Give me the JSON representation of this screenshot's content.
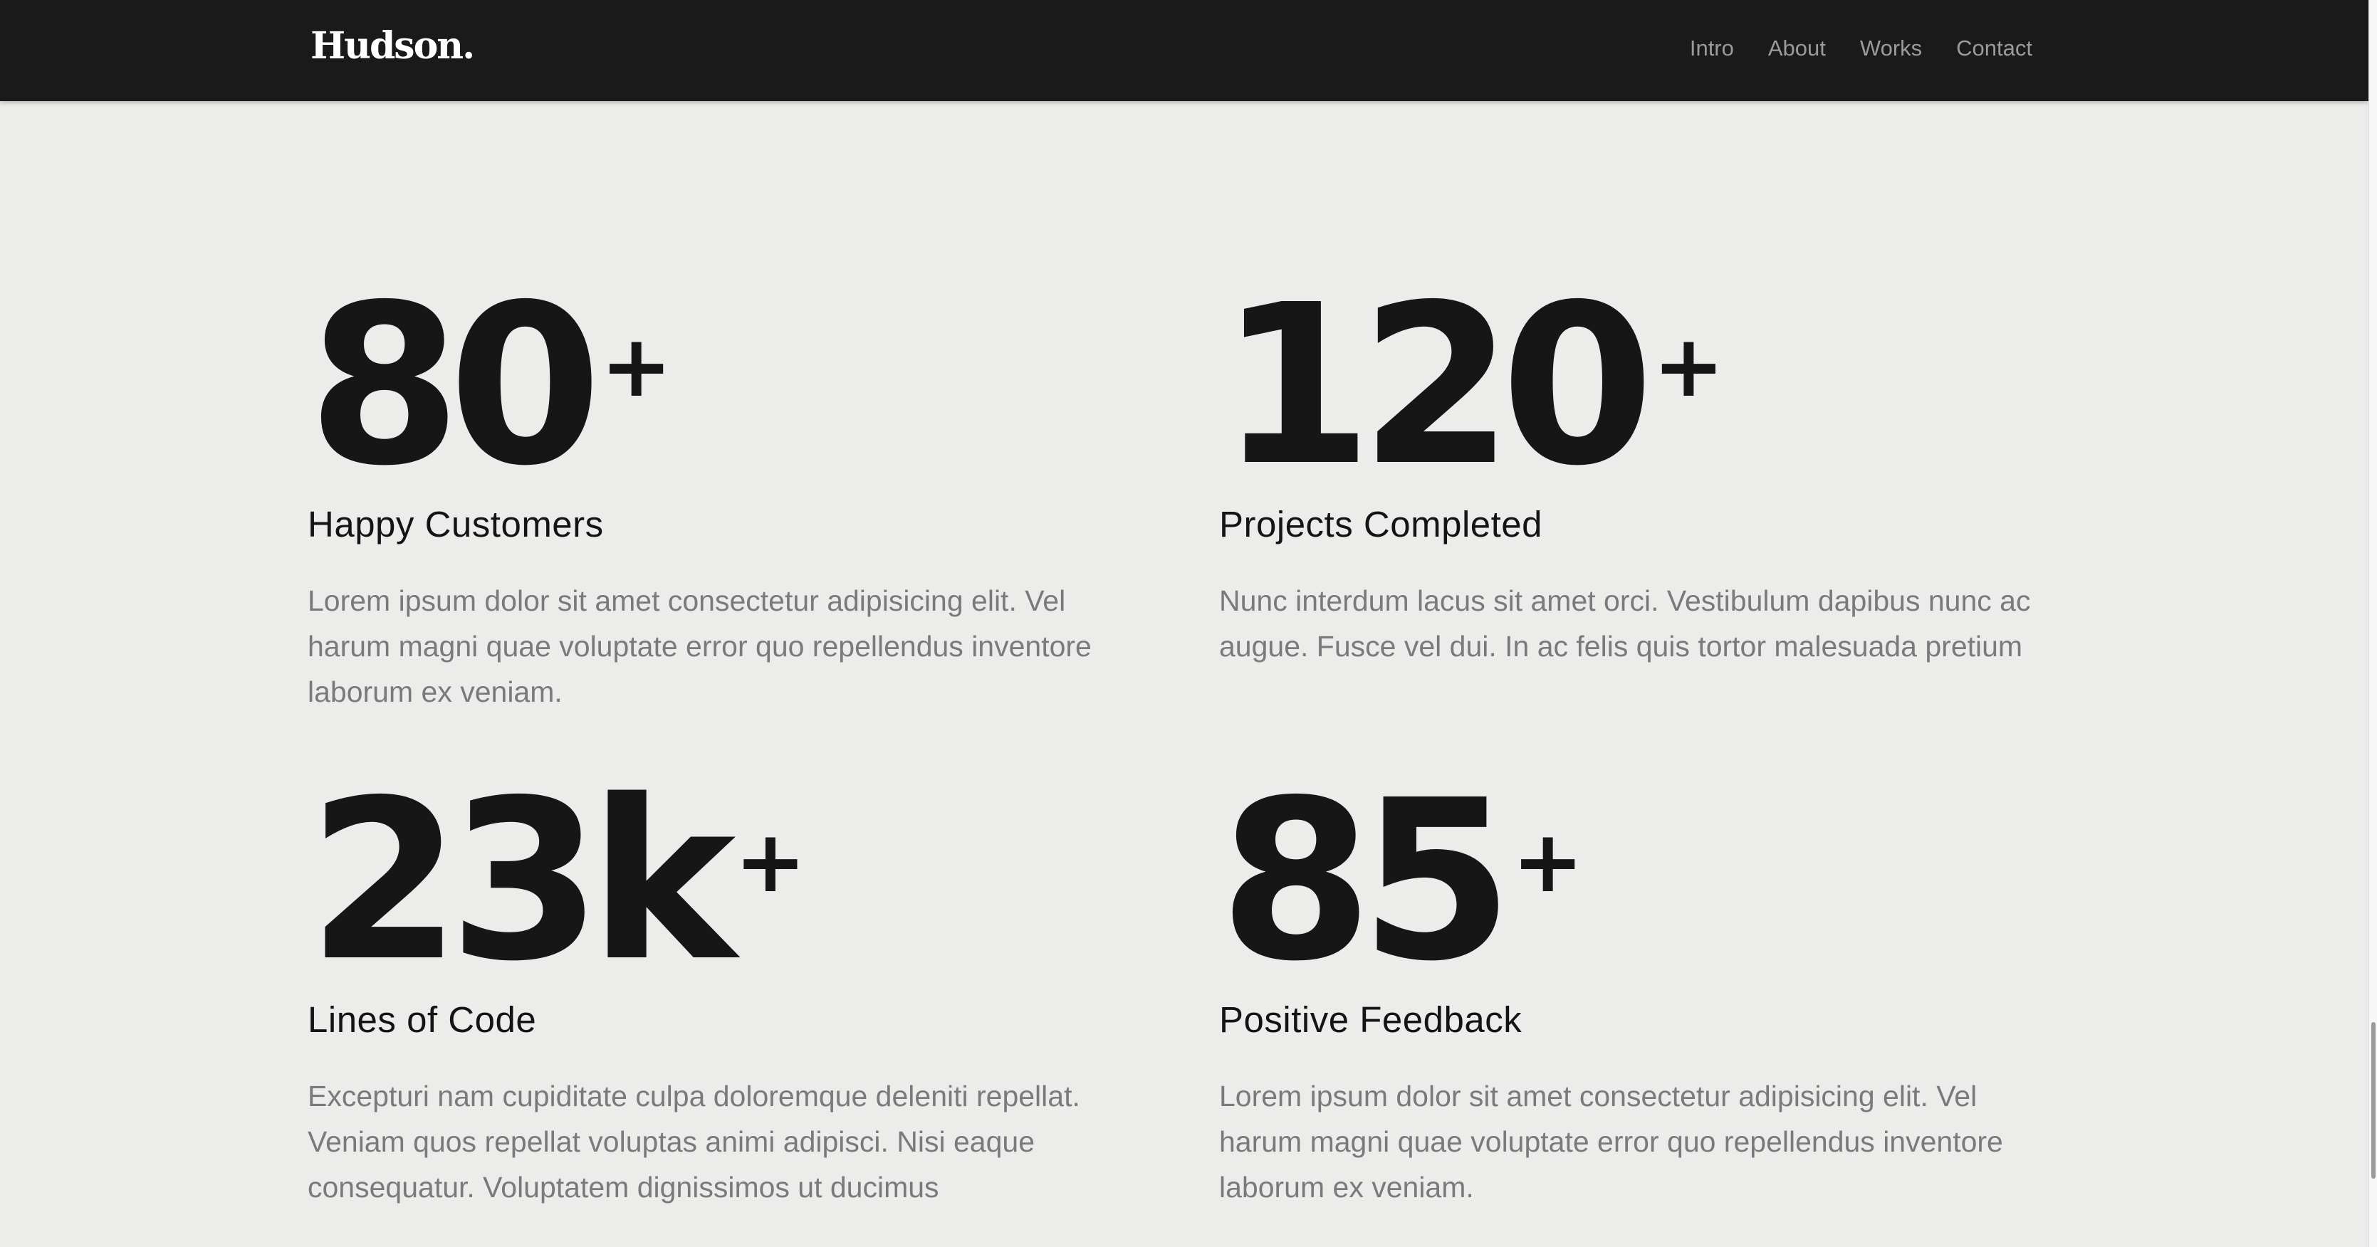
{
  "brand": {
    "logo": "Hudson."
  },
  "nav": {
    "items": [
      {
        "label": "Intro"
      },
      {
        "label": "About"
      },
      {
        "label": "Works"
      },
      {
        "label": "Contact"
      }
    ]
  },
  "stats": [
    {
      "value": "80",
      "suffix": "+",
      "title": "Happy Customers",
      "description": "Lorem ipsum dolor sit amet consectetur adipisicing elit. Vel harum magni quae voluptate error quo repellendus inventore laborum ex veniam."
    },
    {
      "value": "120",
      "suffix": "+",
      "title": "Projects Completed",
      "description": "Nunc interdum lacus sit amet orci. Vestibulum dapibus nunc ac augue. Fusce vel dui. In ac felis quis tortor malesuada pretium"
    },
    {
      "value": "23k",
      "suffix": "+",
      "title": "Lines of Code",
      "description": "Excepturi nam cupiditate culpa doloremque deleniti repellat. Veniam quos repellat voluptas animi adipisci. Nisi eaque consequatur. Voluptatem dignissimos ut ducimus"
    },
    {
      "value": "85",
      "suffix": "+",
      "title": "Positive Feedback",
      "description": "Lorem ipsum dolor sit amet consectetur adipisicing elit. Vel harum magni quae voluptate error quo repellendus inventore laborum ex veniam."
    }
  ],
  "colors": {
    "header_bg": "#1a1a1a",
    "page_bg": "#ecedea",
    "heading": "#161616",
    "body_text": "#7a7a7a",
    "nav_text": "#9b9b9b"
  }
}
